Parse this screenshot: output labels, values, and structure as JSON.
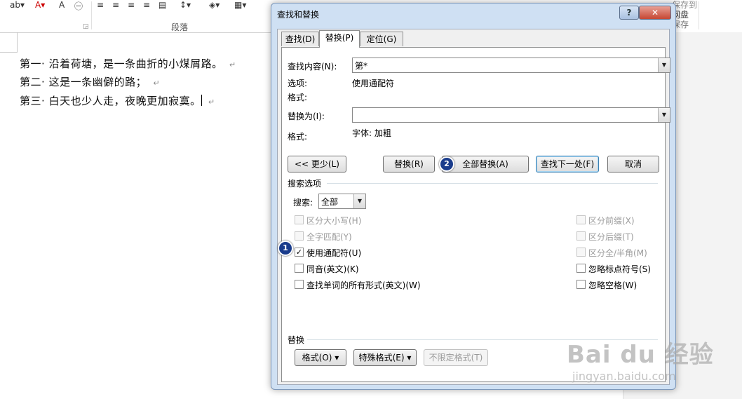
{
  "ribbon": {
    "group_label": "段落",
    "right_line1": "保存到",
    "right_line2": "网盘",
    "right_line3": "保存"
  },
  "document": {
    "lines": [
      {
        "prefix": "第一·",
        "text": "沿着荷塘，是一条曲折的小煤屑路。"
      },
      {
        "prefix": "第二·",
        "text": "这是一条幽僻的路；"
      },
      {
        "prefix": "第三·",
        "text": "白天也少人走，夜晚更加寂寞。"
      }
    ],
    "para_mark": "↵"
  },
  "dialog": {
    "title": "查找和替换",
    "help": "?",
    "close": "✕",
    "tabs": [
      {
        "label": "查找(D)"
      },
      {
        "label": "替换(P)"
      },
      {
        "label": "定位(G)"
      }
    ],
    "find_label": "查找内容(N):",
    "find_value": "第*",
    "options_label": "选项:",
    "options_value": "使用通配符",
    "format_label": "格式:",
    "replace_label": "替换为(I):",
    "replace_value": "",
    "replace_format_label": "格式:",
    "replace_format_value": "字体: 加粗",
    "buttons": {
      "less": "<< 更少(L)",
      "replace": "替换(R)",
      "replace_all": "全部替换(A)",
      "find_next": "查找下一处(F)",
      "cancel": "取消"
    },
    "search_options_title": "搜索选项",
    "search_label": "搜索:",
    "search_value": "全部",
    "left_checks": [
      {
        "label": "区分大小写(H)",
        "checked": false,
        "disabled": true
      },
      {
        "label": "全字匹配(Y)",
        "checked": false,
        "disabled": true
      },
      {
        "label": "使用通配符(U)",
        "checked": true,
        "disabled": false
      },
      {
        "label": "同音(英文)(K)",
        "checked": false,
        "disabled": false
      },
      {
        "label": "查找单词的所有形式(英文)(W)",
        "checked": false,
        "disabled": false
      }
    ],
    "right_checks": [
      {
        "label": "区分前缀(X)",
        "checked": false,
        "disabled": true
      },
      {
        "label": "区分后缀(T)",
        "checked": false,
        "disabled": true
      },
      {
        "label": "区分全/半角(M)",
        "checked": false,
        "disabled": true
      },
      {
        "label": "忽略标点符号(S)",
        "checked": false,
        "disabled": false
      },
      {
        "label": "忽略空格(W)",
        "checked": false,
        "disabled": false
      }
    ],
    "replace_section_title": "替换",
    "bottom_buttons": {
      "format": "格式(O) ▾",
      "special": "特殊格式(E) ▾",
      "no_format": "不限定格式(T)"
    }
  },
  "badges": {
    "one": "1",
    "two": "2"
  },
  "watermark": {
    "main": "Bai du 经验",
    "sub": "jingyan.baidu.com"
  },
  "colors": {
    "accent": "#1a3c8c",
    "dialog_frame": "#cfe0f3"
  }
}
